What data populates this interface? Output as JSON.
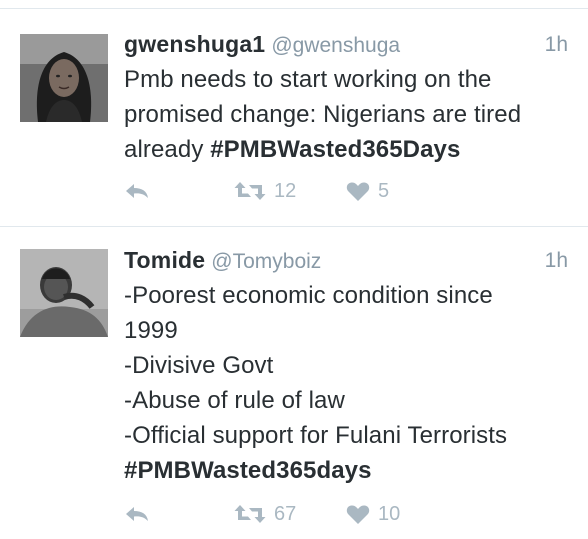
{
  "colors": {
    "text": "#292f33",
    "muted": "#8899a6",
    "icon": "#aab8c2",
    "divider": "#e1e8ed"
  },
  "tweets": [
    {
      "name": "gwenshuga1",
      "handle": "@gwenshuga",
      "time": "1h",
      "lines": [
        "Pmb needs to start working on the",
        "promised change: Nigerians are tired",
        "already"
      ],
      "hashtag": "#PMBWasted365Days",
      "retweets": "12",
      "likes": "5",
      "icons": [
        "reply-icon",
        "retweet-icon",
        "heart-icon"
      ]
    },
    {
      "name": "Tomide",
      "handle": "@Tomyboiz",
      "time": "1h",
      "lines": [
        "-Poorest economic condition since",
        "1999",
        "-Divisive Govt",
        "-Abuse of rule of law",
        "-Official support for Fulani Terrorists"
      ],
      "hashtag": "#PMBWasted365days",
      "retweets": "67",
      "likes": "10",
      "icons": [
        "reply-icon",
        "retweet-icon",
        "heart-icon"
      ]
    }
  ]
}
